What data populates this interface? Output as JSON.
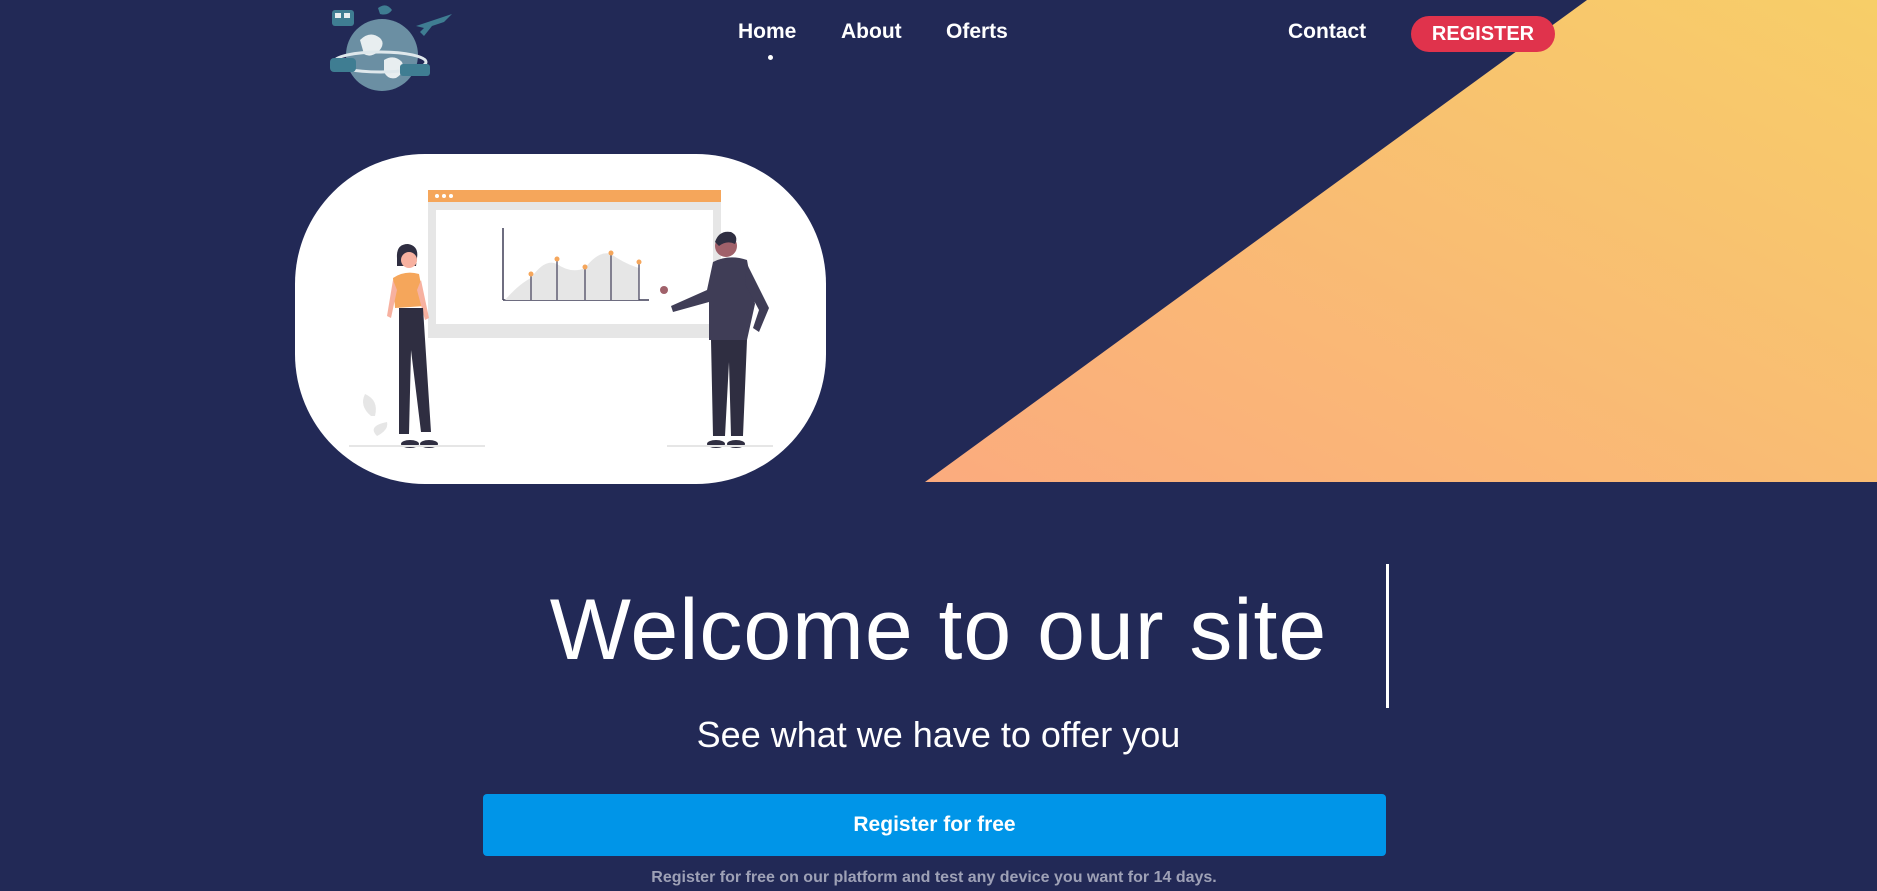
{
  "nav": {
    "home": "Home",
    "about": "About",
    "oferts": "Oferts",
    "contact": "Contact",
    "register": "REGISTER",
    "active": "Home"
  },
  "logo": {
    "icon": "travel-globe-logo"
  },
  "hero": {
    "illustration": "presentation-chart-illustration",
    "title": "Welcome to our site",
    "subtitle": "See what we have to offer you",
    "cta_label": "Register for free",
    "note": "Register for free on our platform and test any device you want for 14 days."
  },
  "colors": {
    "background": "#222956",
    "accent_gradient_start": "#fbab7e",
    "accent_gradient_end": "#f7ce68",
    "register_pill": "#e0334c",
    "cta": "#0095e8",
    "note_text": "#9ea1b6"
  }
}
